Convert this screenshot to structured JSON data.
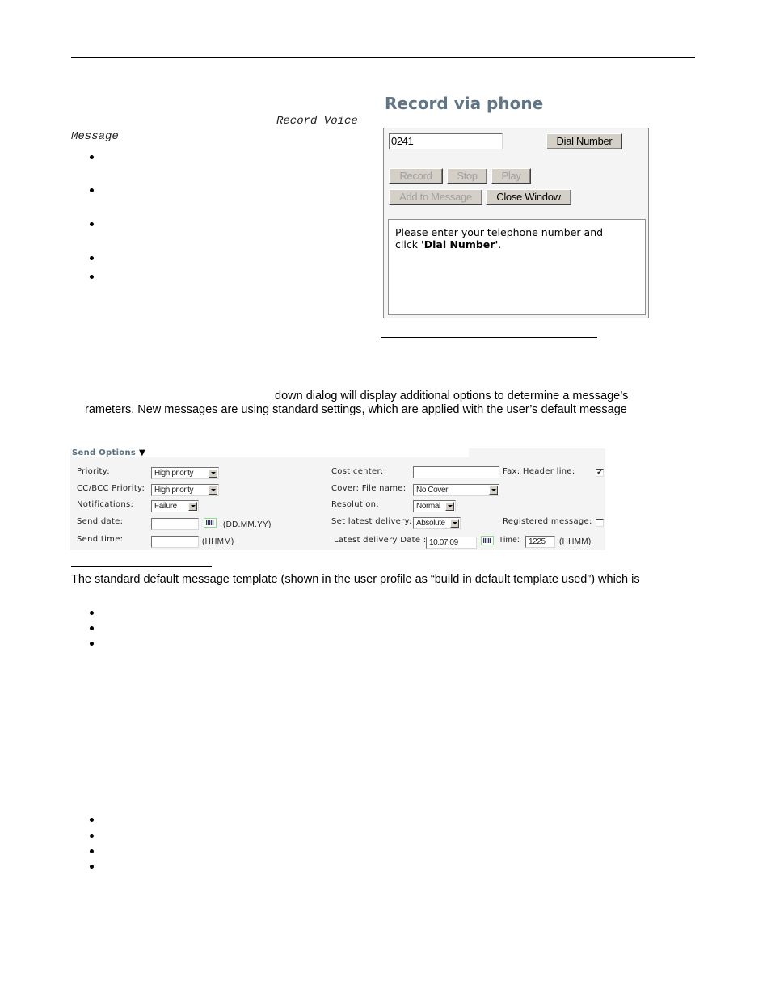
{
  "document": {
    "inline_code_1": "Record Voice",
    "inline_code_2": "Message",
    "para1_line1": "down dialog will display additional options to determine a message’s",
    "para1_line2": "rameters. New messages are using standard settings, which are applied with the user’s default message",
    "para2_line1": "The standard default message template (shown in the user profile as “build in default template used”) which is"
  },
  "record_via_phone": {
    "title": "Record via phone",
    "phone_value": "0241",
    "dial_button": "Dial Number",
    "record_button": "Record",
    "stop_button": "Stop",
    "play_button": "Play",
    "add_button": "Add to Message",
    "close_button": "Close Window",
    "message_line1": "Please enter your telephone number and",
    "message_prefix": "click ",
    "message_bold": "'Dial Number'",
    "message_suffix": "."
  },
  "send_options": {
    "header": "Send Options",
    "priority_label": "Priority:",
    "priority_value": "High priority",
    "ccbcc_label": "CC/BCC Priority:",
    "ccbcc_value": "High priority",
    "notifications_label": "Notifications:",
    "notifications_value": "Failure",
    "send_date_label": "Send date:",
    "send_date_value": "",
    "send_date_format": "(DD.MM.YY)",
    "send_time_label": "Send time:",
    "send_time_value": "",
    "send_time_format": "(HHMM)",
    "cost_center_label": "Cost center:",
    "cost_center_value": "",
    "cover_label": "Cover: File name:",
    "cover_value": "No Cover",
    "resolution_label": "Resolution:",
    "resolution_value": "Normal",
    "latest_label": "Set latest delivery:",
    "latest_value": "Absolute",
    "latest_date_label": "Latest delivery Date :",
    "latest_date_value": "10.07.09",
    "time_label": "Time:",
    "time_value": "1225",
    "time_format": "(HHMM)",
    "fax_header_label": "Fax: Header line:",
    "fax_header_checked": true,
    "registered_label": "Registered message:",
    "registered_checked": false
  }
}
